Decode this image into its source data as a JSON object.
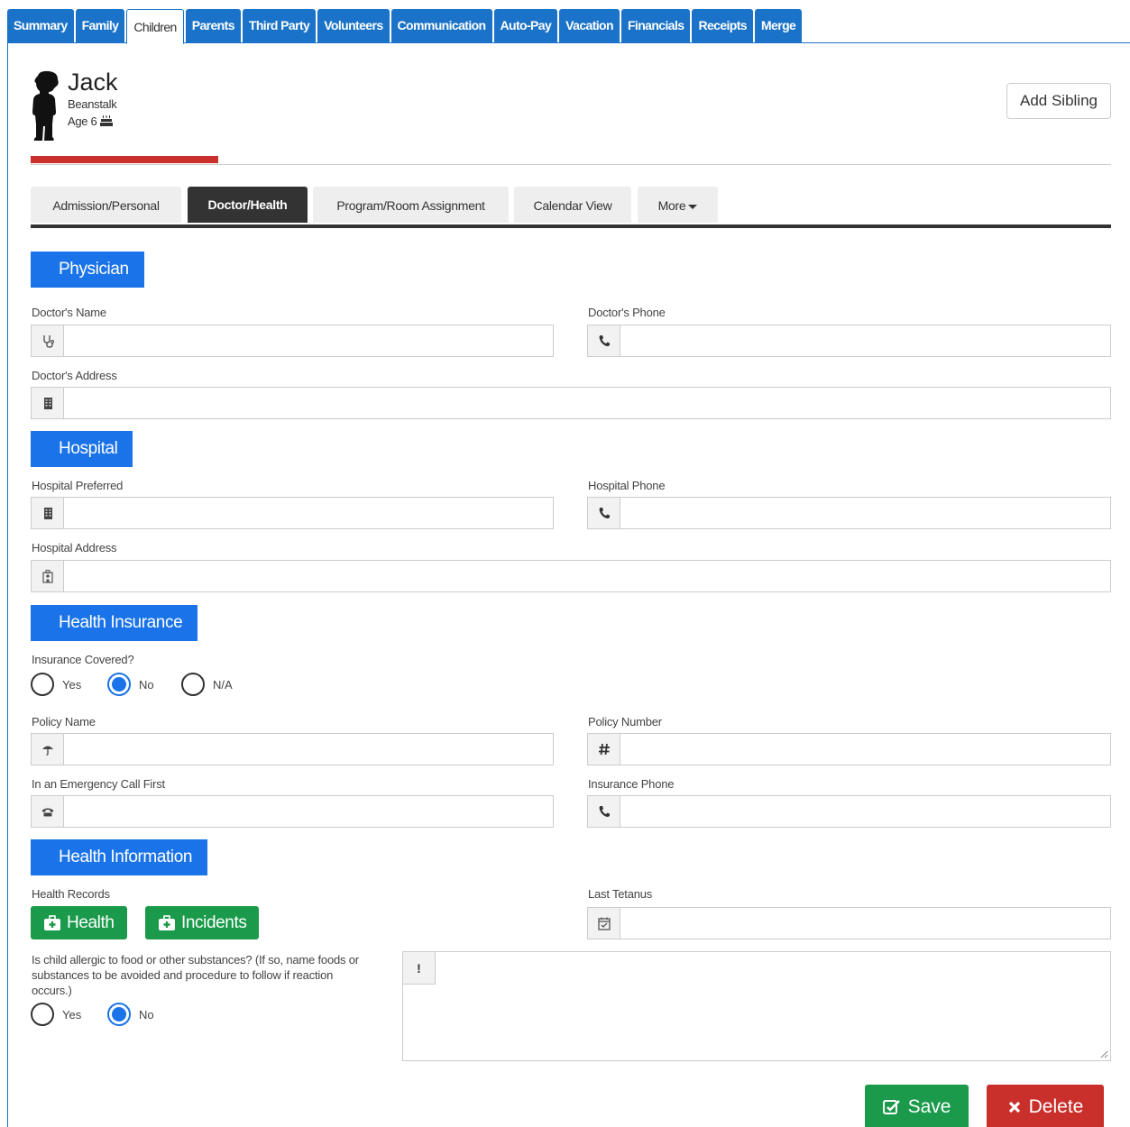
{
  "top_tabs": [
    "Summary",
    "Family",
    "Children",
    "Parents",
    "Third Party",
    "Volunteers",
    "Communication",
    "Auto-Pay",
    "Vacation",
    "Financials",
    "Receipts",
    "Merge"
  ],
  "active_top_tab": "Children",
  "child": {
    "first_name": "Jack",
    "last_name": "Beanstalk",
    "age": "Age 6"
  },
  "add_sibling_label": "Add Sibling",
  "sub_tabs": [
    "Admission/Personal",
    "Doctor/Health",
    "Program/Room Assignment",
    "Calendar View",
    "More"
  ],
  "active_sub_tab": "Doctor/Health",
  "sections": {
    "physician": "Physician",
    "hospital": "Hospital",
    "health_insurance": "Health Insurance",
    "health_information": "Health Information"
  },
  "fields": {
    "doctor_name": {
      "label": "Doctor's Name",
      "value": ""
    },
    "doctor_phone": {
      "label": "Doctor's Phone",
      "value": ""
    },
    "doctor_address": {
      "label": "Doctor's Address",
      "value": ""
    },
    "hospital_preferred": {
      "label": "Hospital Preferred",
      "value": ""
    },
    "hospital_phone": {
      "label": "Hospital Phone",
      "value": ""
    },
    "hospital_address": {
      "label": "Hospital Address",
      "value": ""
    },
    "policy_name": {
      "label": "Policy Name",
      "value": ""
    },
    "policy_number": {
      "label": "Policy Number",
      "value": ""
    },
    "emergency_call": {
      "label": "In an Emergency Call First",
      "value": ""
    },
    "insurance_phone": {
      "label": "Insurance Phone",
      "value": ""
    },
    "last_tetanus": {
      "label": "Last Tetanus",
      "value": ""
    }
  },
  "insurance_covered": {
    "label": "Insurance Covered?",
    "options": [
      "Yes",
      "No",
      "N/A"
    ],
    "selected": "No"
  },
  "health_records": {
    "label": "Health Records",
    "health_button": "Health",
    "incidents_button": "Incidents"
  },
  "allergy": {
    "question": "Is child allergic to food or other substances? (If so, name foods or substances to be avoided and procedure to follow if reaction occurs.)",
    "options": [
      "Yes",
      "No"
    ],
    "selected": "No",
    "details": ""
  },
  "actions": {
    "save": "Save",
    "delete": "Delete"
  },
  "colors": {
    "tab_blue": "#1a73c8",
    "section_blue": "#1a73e8",
    "save_green": "#1a9a4a",
    "delete_red": "#c9302c",
    "dark_tab": "#333333"
  }
}
